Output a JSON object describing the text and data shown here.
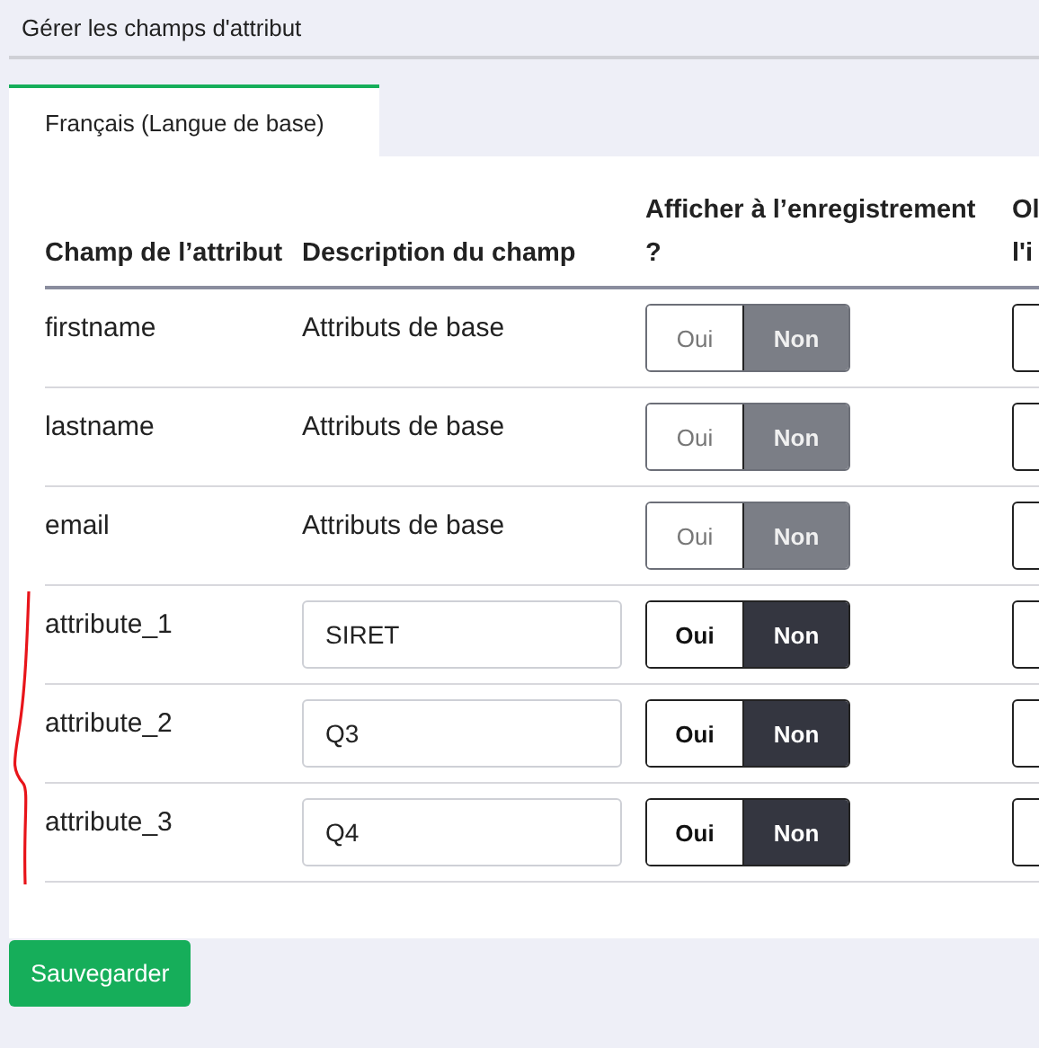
{
  "page_title": "Gérer les champs d'attribut",
  "tabs": [
    {
      "label": "Français (Langue de base)",
      "selected": true
    }
  ],
  "table": {
    "columns": [
      "Champ de l’attribut",
      "Description du champ",
      "Afficher à l’enregistrement ?",
      "Ol\nl'i"
    ],
    "rows": [
      {
        "field": "firstname",
        "kind": "text",
        "description": "Attributs de base",
        "disabled": true,
        "display": [
          {
            "label": "Oui",
            "selected": false
          },
          {
            "label": "Non",
            "selected": true
          }
        ]
      },
      {
        "field": "lastname",
        "kind": "text",
        "description": "Attributs de base",
        "disabled": true,
        "display": [
          {
            "label": "Oui",
            "selected": false
          },
          {
            "label": "Non",
            "selected": true
          }
        ]
      },
      {
        "field": "email",
        "kind": "text",
        "description": "Attributs de base",
        "disabled": true,
        "display": [
          {
            "label": "Oui",
            "selected": false
          },
          {
            "label": "Non",
            "selected": true
          }
        ]
      },
      {
        "field": "attribute_1",
        "kind": "input",
        "description": "SIRET",
        "disabled": false,
        "display": [
          {
            "label": "Oui",
            "selected": false
          },
          {
            "label": "Non",
            "selected": true
          }
        ]
      },
      {
        "field": "attribute_2",
        "kind": "input",
        "description": "Q3",
        "disabled": false,
        "display": [
          {
            "label": "Oui",
            "selected": false
          },
          {
            "label": "Non",
            "selected": true
          }
        ]
      },
      {
        "field": "attribute_3",
        "kind": "input",
        "description": "Q4",
        "disabled": false,
        "display": [
          {
            "label": "Oui",
            "selected": false
          },
          {
            "label": "Non",
            "selected": true
          }
        ]
      }
    ]
  },
  "save_button": "Sauvegarder"
}
